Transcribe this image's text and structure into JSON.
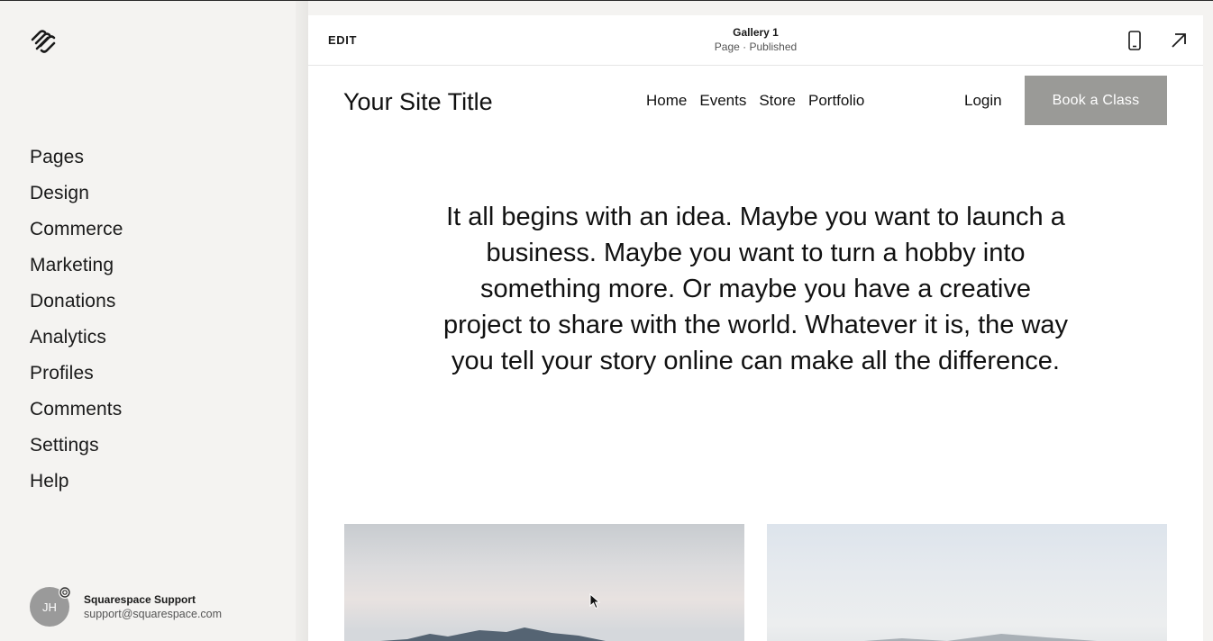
{
  "sidebar": {
    "nav_items": [
      {
        "label": "Pages"
      },
      {
        "label": "Design"
      },
      {
        "label": "Commerce"
      },
      {
        "label": "Marketing"
      },
      {
        "label": "Donations"
      },
      {
        "label": "Analytics"
      },
      {
        "label": "Profiles"
      },
      {
        "label": "Comments"
      },
      {
        "label": "Settings"
      },
      {
        "label": "Help"
      }
    ],
    "user": {
      "initials": "JH",
      "name": "Squarespace Support",
      "email": "support@squarespace.com"
    }
  },
  "toolbar": {
    "edit_label": "EDIT",
    "page_name": "Gallery 1",
    "page_status": "Page · Published",
    "icons": [
      "mobile-preview-icon",
      "open-external-icon"
    ]
  },
  "site": {
    "title": "Your Site Title",
    "nav": [
      "Home",
      "Events",
      "Store",
      "Portfolio"
    ],
    "login_label": "Login",
    "cta_label": "Book a Class",
    "cta_color": "#9a9a97",
    "intro": "It all begins with an idea. Maybe you want to launch a business. Maybe you want to turn a hobby into something more. Or maybe you have a creative project to share with the world. Whatever it is, the way you tell your story online can make all the difference."
  }
}
